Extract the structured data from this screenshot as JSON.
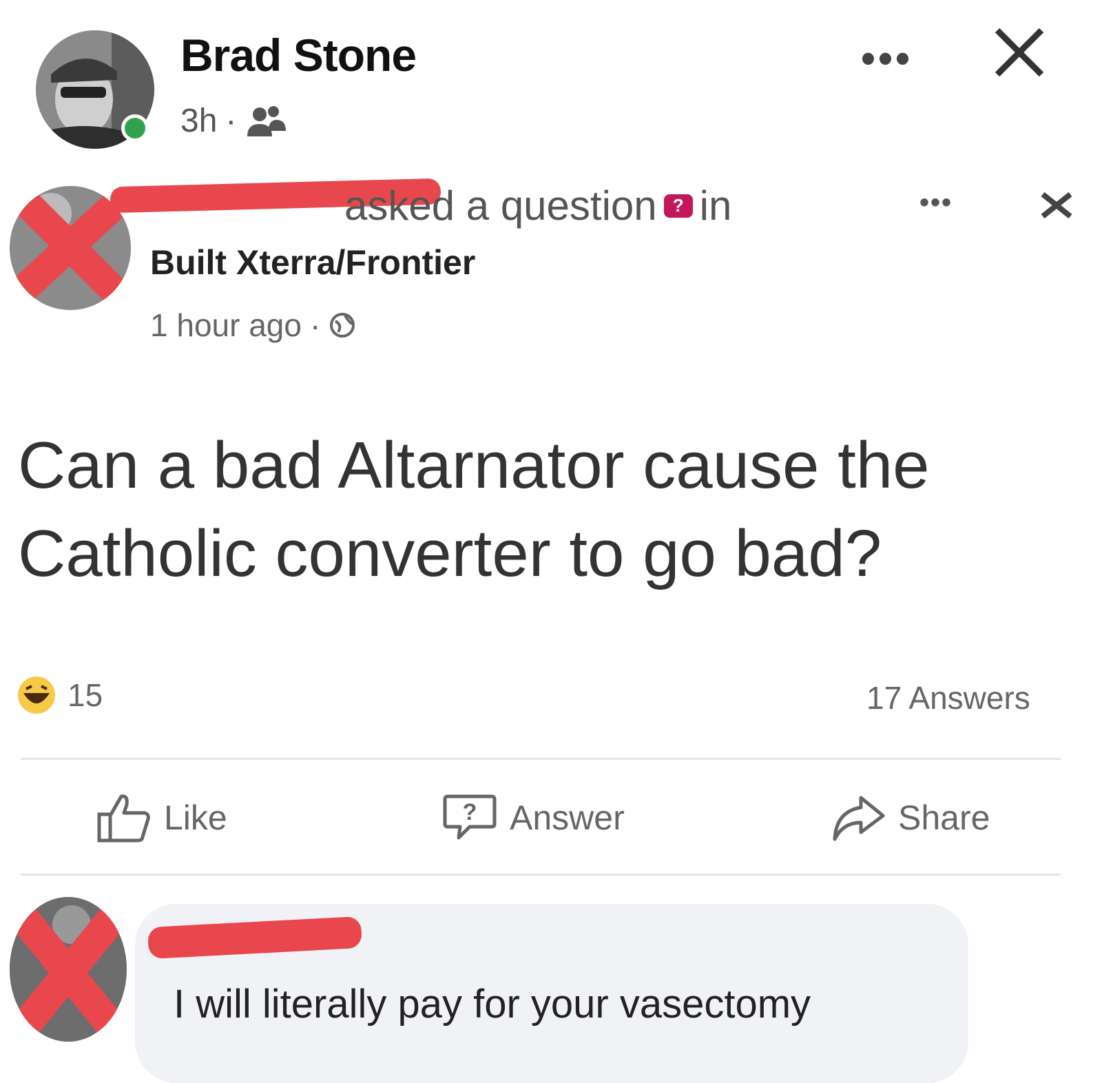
{
  "outer_post": {
    "author": "Brad Stone",
    "time": "3h",
    "separator": "·",
    "audience_icon": "friends-icon",
    "more_label": "•••"
  },
  "inner_post": {
    "action_text": "asked a question",
    "in_text": "in",
    "group_name": "Built Xterra/Frontier",
    "time": "1 hour ago",
    "separator": "·",
    "audience_icon": "globe-icon",
    "more_label": "•••",
    "question_badge": "?"
  },
  "question": {
    "text": "Can a bad Altarnator cause the Catholic converter to go bad?"
  },
  "stats": {
    "reaction_icon": "laugh-emoji-icon",
    "reaction_count": "15",
    "answers": "17 Answers"
  },
  "actions": {
    "like": "Like",
    "answer": "Answer",
    "share": "Share"
  },
  "comment": {
    "text": "I will literally pay for your vasectomy"
  },
  "colors": {
    "online": "#31a24c",
    "redaction": "#e8474e",
    "question_badge": "#c2185b",
    "comment_bubble": "#f0f2f5"
  }
}
